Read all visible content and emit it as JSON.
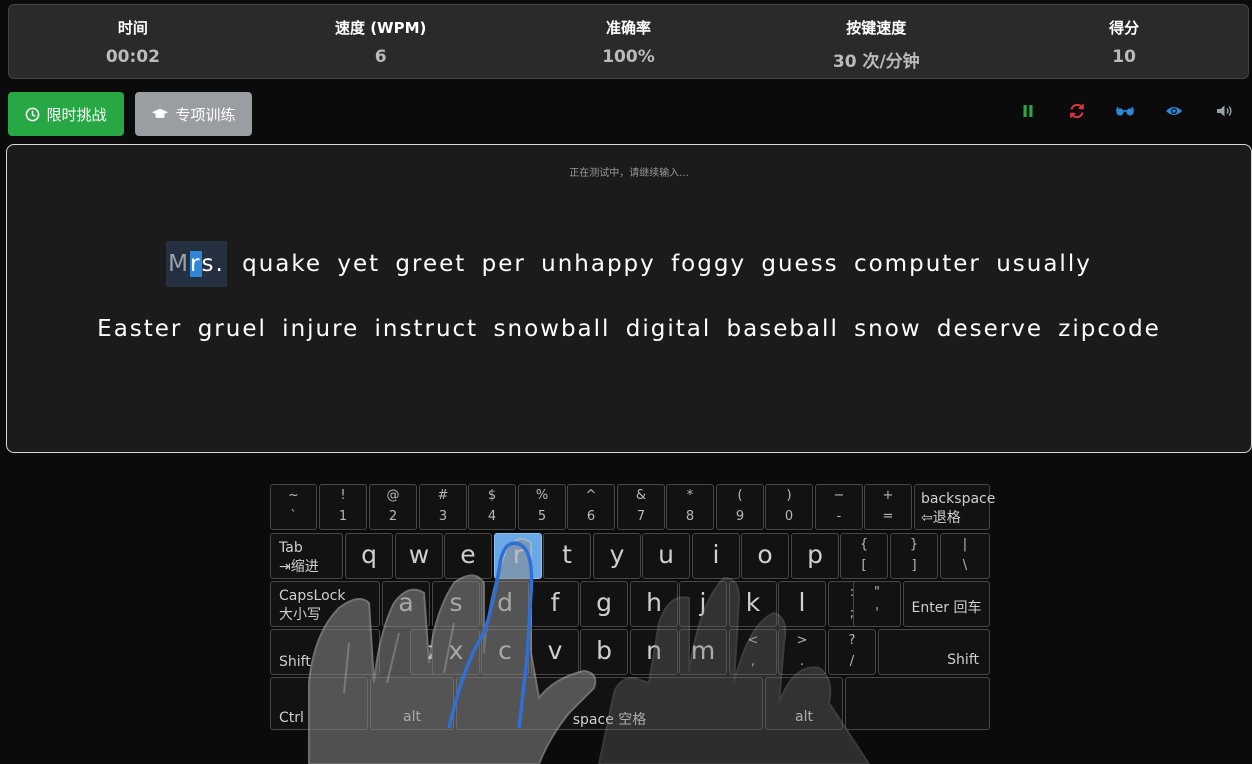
{
  "stats": {
    "time_label": "时间",
    "time_value": "00:02",
    "speed_label": "速度 (WPM)",
    "speed_value": "6",
    "accuracy_label": "准确率",
    "accuracy_value": "100%",
    "keyspeed_label": "按键速度",
    "keyspeed_value": "30 次/分钟",
    "score_label": "得分",
    "score_value": "10"
  },
  "modes": {
    "challenge_label": "限时挑战",
    "training_label": "专项训练"
  },
  "toolbar": {
    "icons": [
      "pause-icon",
      "restart-icon",
      "glasses-icon",
      "eye-icon",
      "volume-icon"
    ],
    "colors": {
      "pause": "#28a745",
      "restart": "#dc3545",
      "glasses": "#2f86d6",
      "eye": "#2f86d6",
      "volume": "#9aa3ab"
    }
  },
  "typing": {
    "status": "正在测试中，请继续输入...",
    "current_typed": "M",
    "current_cursor": "r",
    "current_rest": "s.",
    "line1_rest": " quake yet greet per unhappy foggy guess computer usually",
    "line2": "Easter gruel injure instruct snowball digital baseball snow deserve zipcode"
  },
  "keyboard": {
    "active_key": "r",
    "row1": [
      {
        "top": "~",
        "bot": "`"
      },
      {
        "top": "!",
        "bot": "1"
      },
      {
        "top": "@",
        "bot": "2"
      },
      {
        "top": "#",
        "bot": "3"
      },
      {
        "top": "$",
        "bot": "4"
      },
      {
        "top": "%",
        "bot": "5"
      },
      {
        "top": "^",
        "bot": "6"
      },
      {
        "top": "&",
        "bot": "7"
      },
      {
        "top": "*",
        "bot": "8"
      },
      {
        "top": "(",
        "bot": "9"
      },
      {
        "top": ")",
        "bot": "0"
      },
      {
        "top": "−",
        "bot": "-"
      },
      {
        "top": "+",
        "bot": "="
      }
    ],
    "backspace_1": "backspace",
    "backspace_2": "⇦退格",
    "tab_1": "Tab",
    "tab_2": "⇥缩进",
    "row2": [
      "q",
      "w",
      "e",
      "r",
      "t",
      "y",
      "u",
      "i",
      "o",
      "p"
    ],
    "row2_sym": [
      {
        "top": "{",
        "bot": "["
      },
      {
        "top": "}",
        "bot": "]"
      },
      {
        "top": "|",
        "bot": "\\"
      }
    ],
    "caps_1": "CapsLock",
    "caps_2": "大小写",
    "row3": [
      "a",
      "s",
      "d",
      "f",
      "g",
      "h",
      "j",
      "k",
      "l"
    ],
    "row3_sym": [
      {
        "top": ":",
        "bot": ";"
      },
      {
        "top": "\"",
        "bot": "'"
      }
    ],
    "enter": "Enter 回车",
    "shift": "Shift",
    "row4": [
      "z",
      "x",
      "c",
      "v",
      "b",
      "n",
      "m"
    ],
    "row4_sym": [
      {
        "top": "<",
        "bot": ","
      },
      {
        "top": ">",
        "bot": "."
      },
      {
        "top": "?",
        "bot": "/"
      }
    ],
    "ctrl": "Ctrl",
    "alt": "alt",
    "space": "space 空格"
  }
}
